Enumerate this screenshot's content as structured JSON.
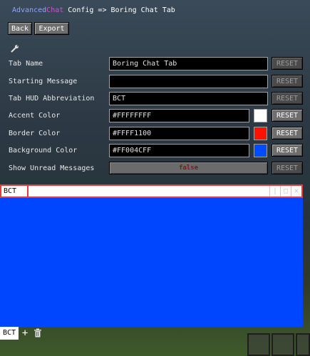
{
  "title": {
    "part1": "Advanced",
    "part2": "Chat",
    "part3": " Config => Boring Chat Tab"
  },
  "toolbar": {
    "back_label": "Back",
    "export_label": "Export"
  },
  "icons": {
    "settings": "wrench-icon",
    "add": "plus-icon",
    "delete": "trash-icon"
  },
  "reset_label": "RESET",
  "fields": {
    "tab_name": {
      "label": "Tab Name",
      "value": "Boring Chat Tab"
    },
    "starting_message": {
      "label": "Starting Message",
      "value": ""
    },
    "hud_abbrev": {
      "label": "Tab HUD Abbreviation",
      "value": "BCT"
    },
    "accent_color": {
      "label": "Accent Color",
      "value": "#FFFFFFFF",
      "swatch": "#ffffff"
    },
    "border_color": {
      "label": "Border Color",
      "value": "#FFFF1100",
      "swatch": "#ff1100"
    },
    "background_color": {
      "label": "Background Color",
      "value": "#FF004CFF",
      "swatch": "#004cff"
    },
    "show_unread": {
      "label": "Show Unread Messages",
      "value": "false"
    }
  },
  "preview": {
    "tab_abbrev": "BCT",
    "bottom_tab": "BCT"
  },
  "colors": {
    "border": "#ff1100",
    "background": "#004cff",
    "accent": "#ffffff"
  }
}
